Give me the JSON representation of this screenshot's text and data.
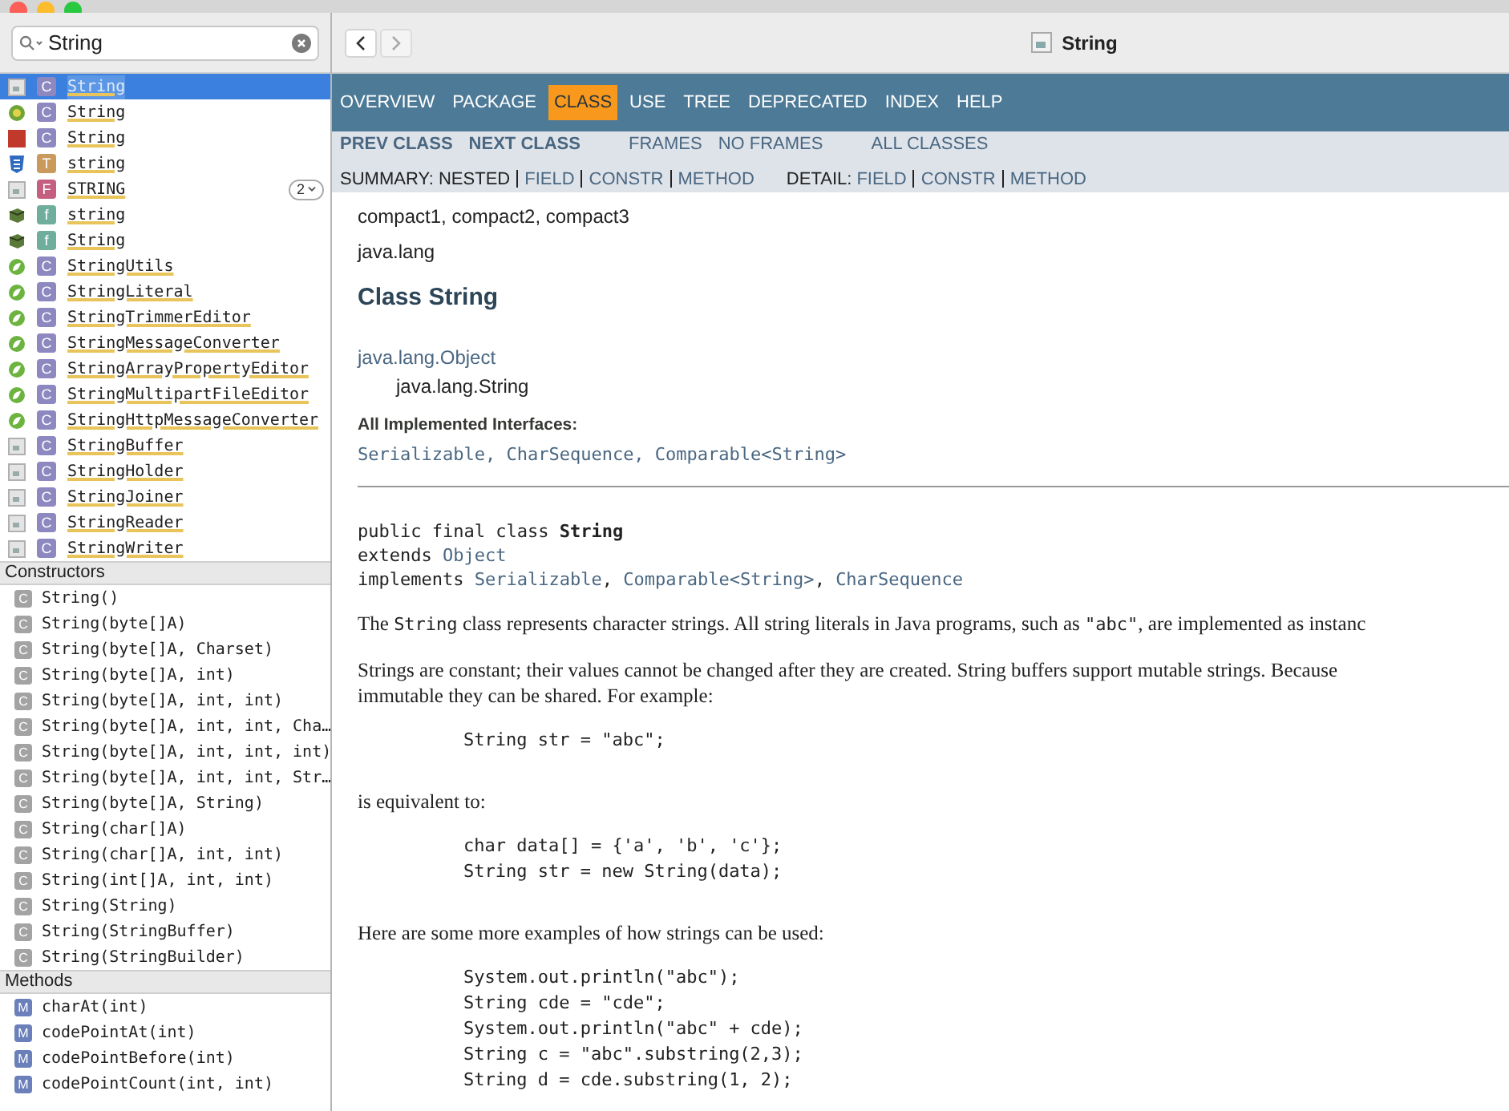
{
  "search": {
    "value": "String"
  },
  "results": [
    {
      "kind": "java",
      "type": "C",
      "name": "String",
      "selected": true
    },
    {
      "kind": "grails",
      "type": "C",
      "name": "String",
      "selected": false
    },
    {
      "kind": "js",
      "type": "C",
      "name": "String",
      "selected": false
    },
    {
      "kind": "css",
      "type": "T",
      "name": "string",
      "selected": false
    },
    {
      "kind": "java",
      "type": "F",
      "name": "STRING",
      "selected": false,
      "badge": "2"
    },
    {
      "kind": "package",
      "type": "f",
      "name": "string",
      "selected": false
    },
    {
      "kind": "package",
      "type": "f",
      "name": "String",
      "selected": false
    },
    {
      "kind": "spring",
      "type": "C",
      "name": "StringUtils",
      "selected": false
    },
    {
      "kind": "spring",
      "type": "C",
      "name": "StringLiteral",
      "selected": false
    },
    {
      "kind": "spring",
      "type": "C",
      "name": "StringTrimmerEditor",
      "selected": false
    },
    {
      "kind": "spring",
      "type": "C",
      "name": "StringMessageConverter",
      "selected": false
    },
    {
      "kind": "spring",
      "type": "C",
      "name": "StringArrayPropertyEditor",
      "selected": false
    },
    {
      "kind": "spring",
      "type": "C",
      "name": "StringMultipartFileEditor",
      "selected": false
    },
    {
      "kind": "spring",
      "type": "C",
      "name": "StringHttpMessageConverter",
      "selected": false
    },
    {
      "kind": "java",
      "type": "C",
      "name": "StringBuffer",
      "selected": false
    },
    {
      "kind": "java",
      "type": "C",
      "name": "StringHolder",
      "selected": false
    },
    {
      "kind": "java",
      "type": "C",
      "name": "StringJoiner",
      "selected": false
    },
    {
      "kind": "java",
      "type": "C",
      "name": "StringReader",
      "selected": false
    },
    {
      "kind": "java",
      "type": "C",
      "name": "StringWriter",
      "selected": false
    }
  ],
  "sections": [
    {
      "title": "Constructors",
      "kind": "constructor",
      "items": [
        {
          "icon": "C",
          "signature": "String()"
        },
        {
          "icon": "C",
          "signature": "String(byte[]A)"
        },
        {
          "icon": "C",
          "signature": "String(byte[]A, Charset)"
        },
        {
          "icon": "C",
          "signature": "String(byte[]A, int)"
        },
        {
          "icon": "C",
          "signature": "String(byte[]A, int, int)"
        },
        {
          "icon": "C",
          "signature": "String(byte[]A, int, int, Cha…"
        },
        {
          "icon": "C",
          "signature": "String(byte[]A, int, int, int)"
        },
        {
          "icon": "C",
          "signature": "String(byte[]A, int, int, Str…"
        },
        {
          "icon": "C",
          "signature": "String(byte[]A, String)"
        },
        {
          "icon": "C",
          "signature": "String(char[]A)"
        },
        {
          "icon": "C",
          "signature": "String(char[]A, int, int)"
        },
        {
          "icon": "C",
          "signature": "String(int[]A, int, int)"
        },
        {
          "icon": "C",
          "signature": "String(String)"
        },
        {
          "icon": "C",
          "signature": "String(StringBuffer)"
        },
        {
          "icon": "C",
          "signature": "String(StringBuilder)"
        }
      ]
    },
    {
      "title": "Methods",
      "kind": "method",
      "items": [
        {
          "icon": "M",
          "signature": "charAt(int)"
        },
        {
          "icon": "M",
          "signature": "codePointAt(int)"
        },
        {
          "icon": "M",
          "signature": "codePointBefore(int)"
        },
        {
          "icon": "M",
          "signature": "codePointCount(int, int)"
        }
      ]
    }
  ],
  "page_title": "String",
  "nav": [
    {
      "label": "OVERVIEW",
      "selected": false
    },
    {
      "label": "PACKAGE",
      "selected": false
    },
    {
      "label": "CLASS",
      "selected": true
    },
    {
      "label": "USE",
      "selected": false
    },
    {
      "label": "TREE",
      "selected": false
    },
    {
      "label": "DEPRECATED",
      "selected": false
    },
    {
      "label": "INDEX",
      "selected": false
    },
    {
      "label": "HELP",
      "selected": false
    }
  ],
  "subnav": {
    "class_links": [
      "PREV CLASS",
      "NEXT CLASS"
    ],
    "frame_links": [
      "FRAMES",
      "NO FRAMES"
    ],
    "all_classes": "ALL CLASSES",
    "summary_label": "SUMMARY:",
    "summary": [
      {
        "text": "NESTED",
        "link": false
      },
      {
        "text": "FIELD",
        "link": true
      },
      {
        "text": "CONSTR",
        "link": true
      },
      {
        "text": "METHOD",
        "link": true
      }
    ],
    "detail_label": "DETAIL:",
    "detail": [
      {
        "text": "FIELD",
        "link": true
      },
      {
        "text": "CONSTR",
        "link": true
      },
      {
        "text": "METHOD",
        "link": true
      }
    ]
  },
  "profiles": "compact1, compact2, compact3",
  "package": "java.lang",
  "heading": "Class String",
  "hierarchy": [
    "java.lang.Object",
    "java.lang.String"
  ],
  "interfaces_label": "All Implemented Interfaces:",
  "interfaces": "Serializable, CharSequence, Comparable<String>",
  "declaration": [
    [
      {
        "text": "public final class ",
        "kind": "plain"
      },
      {
        "text": "String",
        "kind": "bold"
      }
    ],
    [
      {
        "text": "extends ",
        "kind": "plain"
      },
      {
        "text": "Object",
        "kind": "link"
      }
    ],
    [
      {
        "text": "implements ",
        "kind": "plain"
      },
      {
        "text": "Serializable",
        "kind": "link"
      },
      {
        "text": ", ",
        "kind": "plain"
      },
      {
        "text": "Comparable<String>",
        "kind": "link"
      },
      {
        "text": ", ",
        "kind": "plain"
      },
      {
        "text": "CharSequence",
        "kind": "link"
      }
    ]
  ],
  "body": [
    {
      "kind": "para",
      "parts": [
        {
          "text": "The ",
          "code": false
        },
        {
          "text": "String",
          "code": true
        },
        {
          "text": " class represents character strings. All string literals in Java programs, such as ",
          "code": false
        },
        {
          "text": "\"abc\"",
          "code": true
        },
        {
          "text": ", are implemented as instanc",
          "code": false
        }
      ]
    },
    {
      "kind": "para",
      "parts": [
        {
          "text": "Strings are constant; their values cannot be changed after they are created. String buffers support mutable strings. Because",
          "code": false
        },
        {
          "text": "immutable they can be shared. For example:",
          "code": false,
          "new_line": true
        }
      ]
    },
    {
      "kind": "code",
      "lines": [
        "String str = \"abc\";"
      ]
    },
    {
      "kind": "para",
      "parts": [
        {
          "text": "is equivalent to:",
          "code": false
        }
      ]
    },
    {
      "kind": "code",
      "lines": [
        "char data[] = {'a', 'b', 'c'};",
        "String str = new String(data);"
      ]
    },
    {
      "kind": "para",
      "parts": [
        {
          "text": "Here are some more examples of how strings can be used:",
          "code": false
        }
      ]
    },
    {
      "kind": "code",
      "lines": [
        "System.out.println(\"abc\");",
        "String cde = \"cde\";",
        "System.out.println(\"abc\" + cde);",
        "String c = \"abc\".substring(2,3);",
        "String d = cde.substring(1, 2);"
      ]
    }
  ]
}
